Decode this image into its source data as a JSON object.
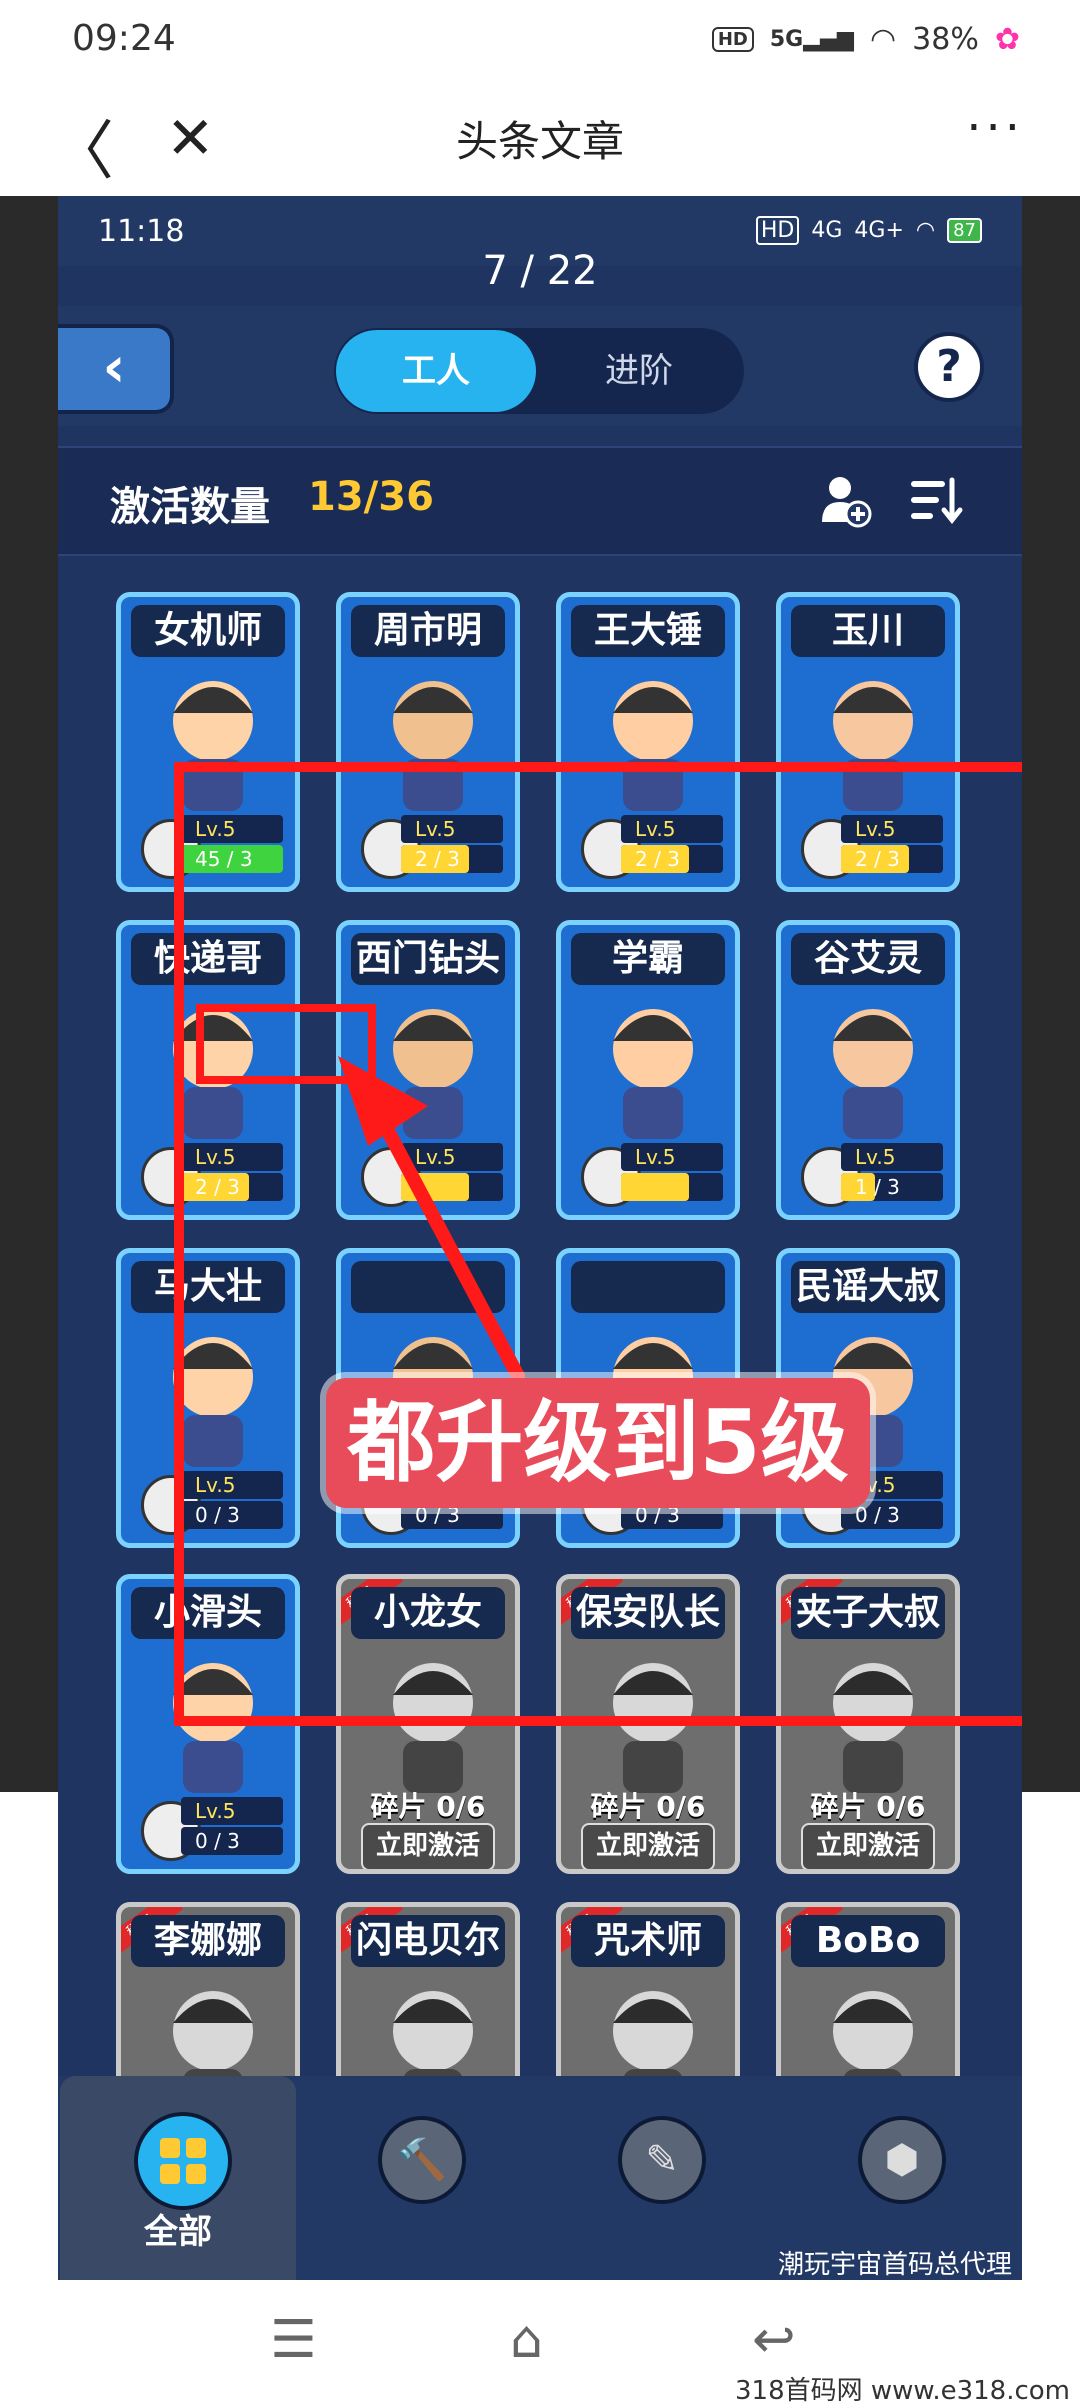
{
  "phone_status": {
    "time": "09:24",
    "battery": "38%",
    "network": "5G",
    "hd": "HD"
  },
  "browser": {
    "title": "头条文章",
    "back_icon": "chevron-left-icon",
    "close_icon": "close-icon",
    "more_icon": "more-icon"
  },
  "game": {
    "status": {
      "time": "11:18",
      "battery": "87",
      "net1": "4G",
      "net2": "4G+"
    },
    "page_counter": "7 / 22",
    "tabs": [
      {
        "label": "工人"
      },
      {
        "label": "进阶"
      }
    ],
    "help": "?",
    "count_label": "激活数量",
    "count_value": "13/36",
    "cards": [
      {
        "name": "女机师",
        "level": "Lv.5",
        "progress": "45 / 3",
        "progress_fraction": 1.0,
        "badge": "wrench",
        "accent": "#3fd33f"
      },
      {
        "name": "周市明",
        "level": "Lv.5",
        "progress": "2 / 3",
        "progress_fraction": 0.67,
        "badge": "hammer",
        "accent": "#ffd633"
      },
      {
        "name": "王大锤",
        "level": "Lv.5",
        "progress": "2 / 3",
        "progress_fraction": 0.67,
        "badge": "hammer",
        "accent": "#ffd633"
      },
      {
        "name": "玉川",
        "level": "Lv.5",
        "progress": "2 / 3",
        "progress_fraction": 0.67,
        "badge": "hammer",
        "accent": "#ffd633"
      },
      {
        "name": "快递哥",
        "level": "Lv.5",
        "progress": "2 / 3",
        "progress_fraction": 0.67,
        "badge": "box",
        "accent": "#ffd633"
      },
      {
        "name": "西门钻头",
        "level": "Lv.5",
        "progress": "",
        "progress_fraction": 0.67,
        "badge": "screwdriver",
        "accent": "#ffd633"
      },
      {
        "name": "学霸",
        "level": "Lv.5",
        "progress": "",
        "progress_fraction": 0.67,
        "badge": "box",
        "accent": "#ffd633"
      },
      {
        "name": "谷艾灵",
        "level": "Lv.5",
        "progress": "1 / 3",
        "progress_fraction": 0.33,
        "badge": "box",
        "accent": "#ffd633"
      },
      {
        "name": "马大壮",
        "level": "Lv.5",
        "progress": "0 / 3",
        "progress_fraction": 0,
        "badge": "hammer",
        "accent": "#ffd633"
      },
      {
        "name": "",
        "level": "Lv.5",
        "progress": "0 / 3",
        "progress_fraction": 0,
        "badge": "screwdriver",
        "accent": "#ffd633"
      },
      {
        "name": "",
        "level": "Lv.5",
        "progress": "0 / 3",
        "progress_fraction": 0,
        "badge": "screwdriver",
        "accent": "#ffd633"
      },
      {
        "name": "民谣大叔",
        "level": "Lv.5",
        "progress": "0 / 3",
        "progress_fraction": 0,
        "badge": "box",
        "accent": "#ffd633"
      },
      {
        "name": "小滑头",
        "level": "Lv.5",
        "progress": "0 / 3",
        "progress_fraction": 0,
        "badge": "box",
        "accent": "#ffd633"
      }
    ],
    "locked_cards": [
      {
        "name": "小龙女",
        "rare": "稀有",
        "fragments": "碎片 0/6",
        "action": "立即激活"
      },
      {
        "name": "保安队长",
        "rare": "稀有",
        "fragments": "碎片 0/6",
        "action": "立即激活"
      },
      {
        "name": "夹子大叔",
        "rare": "稀有",
        "fragments": "碎片 0/6",
        "action": "立即激活"
      },
      {
        "name": "李娜娜",
        "rare": "稀有"
      },
      {
        "name": "闪电贝尔",
        "rare": "稀有"
      },
      {
        "name": "咒术师",
        "rare": "稀有"
      },
      {
        "name": "BoBo",
        "rare": "稀有"
      }
    ],
    "overlay_text": "都升级到5级",
    "nav": {
      "all_label": "全部",
      "icons": [
        "hammer-icon",
        "screwdriver-icon",
        "box-icon"
      ]
    },
    "watermark": "潮玩宇宙首码总代理"
  },
  "site_mark": "318首码网  www.e318.com",
  "colors": {
    "game_bg": "#1f3460",
    "card_blue": "#1d6ed0",
    "accent_yellow": "#ffc933",
    "highlight_red": "#ff1a1a",
    "tab_active": "#27b3ef"
  }
}
